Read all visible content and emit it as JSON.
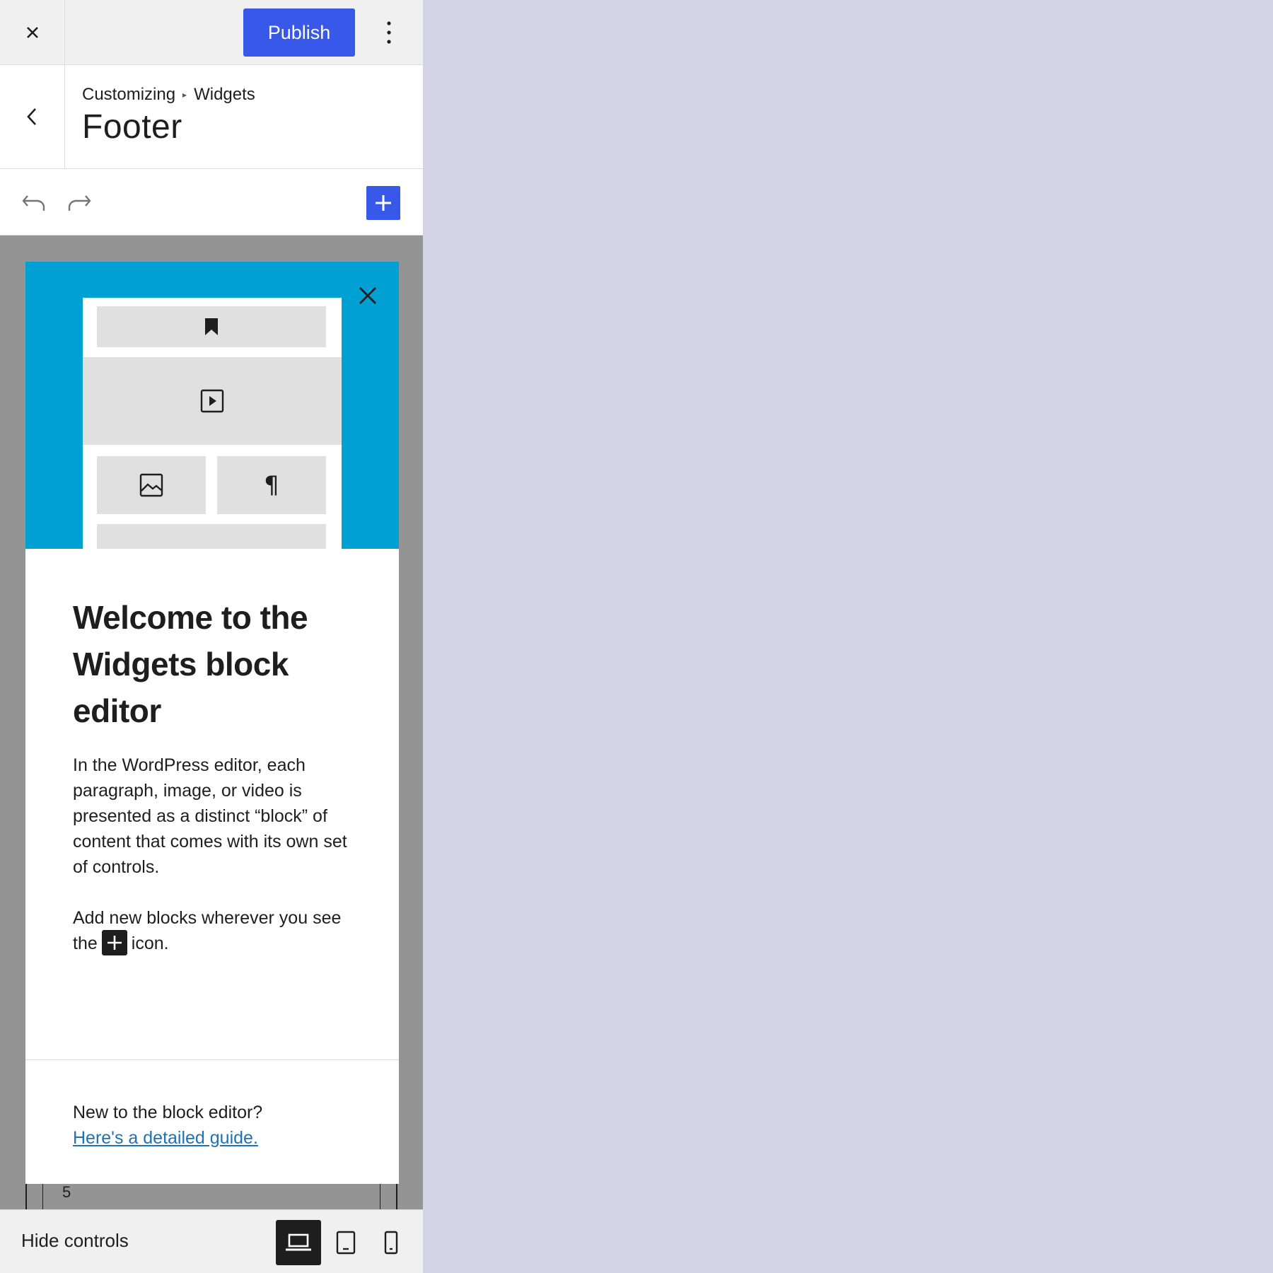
{
  "topbar": {
    "close_icon": "close-icon",
    "publish_label": "Publish",
    "more_icon": "more-vertical-icon",
    "accent_color": "#3858e9"
  },
  "section": {
    "back_icon": "chevron-left-icon",
    "breadcrumb": [
      "Customizing",
      "Widgets"
    ],
    "breadcrumb_separator": "▸",
    "title": "Footer"
  },
  "toolbar": {
    "undo_icon": "undo-icon",
    "redo_icon": "redo-icon",
    "inserter_icon": "plus-icon"
  },
  "welcome_guide": {
    "close_icon": "close-icon",
    "illustration_color": "#00a0d2",
    "illustration_icons": [
      "bookmark-icon",
      "video-icon",
      "image-icon",
      "paragraph-icon"
    ],
    "pilcrow": "¶",
    "heading": "Welcome to the Widgets block editor",
    "paragraph1": "In the WordPress editor, each paragraph, image, or video is presented as a distinct “block” of content that comes with its own set of controls.",
    "paragraph2_before": "Add new blocks wherever you see the",
    "paragraph2_after": "icon.",
    "footer_text": "New to the block editor?",
    "footer_link": "Here's a detailed guide."
  },
  "background_block": {
    "number": "5"
  },
  "bottom_bar": {
    "hide_controls_label": "Hide controls",
    "devices": [
      "desktop-icon",
      "tablet-icon",
      "mobile-icon"
    ],
    "active_device": "desktop"
  }
}
